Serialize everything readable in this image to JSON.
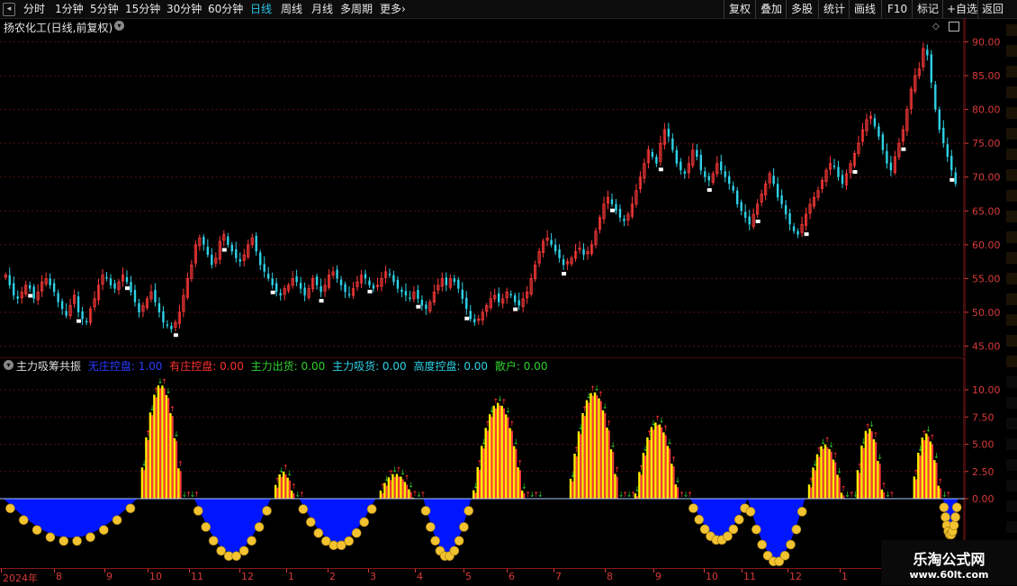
{
  "toolbar": {
    "periods": [
      "分时",
      "1分钟",
      "5分钟",
      "15分钟",
      "30分钟",
      "60分钟",
      "日线",
      "周线",
      "月线",
      "多周期",
      "更多"
    ],
    "active_period": "日线",
    "more_arrow": "›",
    "right_buttons": [
      "复权",
      "叠加",
      "多股",
      "统计",
      "画线",
      "F10",
      "标记",
      "+自选",
      "返回"
    ]
  },
  "main": {
    "title": "扬农化工(日线,前复权)",
    "y_ticks": [
      "90.00",
      "85.00",
      "80.00",
      "75.00",
      "70.00",
      "65.00",
      "60.00",
      "55.00",
      "50.00",
      "45.00"
    ]
  },
  "sub": {
    "indicator_name": "主力吸筹共振",
    "values": [
      {
        "label": "无庄控盘: 1.00",
        "color": "#2a3cff"
      },
      {
        "label": "有庄控盘: 0.00",
        "color": "#ff3030"
      },
      {
        "label": "主力出货: 0.00",
        "color": "#2ed12e"
      },
      {
        "label": "主力吸货: 0.00",
        "color": "#2ed1e6"
      },
      {
        "label": "高度控盘: 0.00",
        "color": "#2ed1e6"
      },
      {
        "label": "散户: 0.00",
        "color": "#2ed12e"
      }
    ],
    "y_ticks": [
      "10.00",
      "7.50",
      "5.00",
      "2.50",
      "0.00"
    ]
  },
  "x_axis": {
    "labels": [
      "2024年",
      "8",
      "9",
      "10",
      "11",
      "12",
      "1",
      "2",
      "3",
      "4",
      "5",
      "6",
      "7",
      "8",
      "9",
      "10",
      "11",
      "12",
      "1"
    ]
  },
  "watermark": {
    "title": "乐淘公式网",
    "url": "www.60lt.com"
  },
  "colors": {
    "up": "#ff3a3a",
    "down": "#2ed1e6",
    "grid": "#5a0f0f",
    "yellow": "#ffee00",
    "blue": "#0016ff"
  },
  "chart_data": {
    "type": "candlestick",
    "ylim": [
      44,
      91
    ],
    "close_series": [
      55.5,
      54,
      52.5,
      52,
      53,
      54,
      53.5,
      52,
      53,
      54.5,
      55,
      54,
      53,
      51.5,
      50.5,
      49.5,
      51,
      52.5,
      50,
      49,
      48.5,
      50.5,
      52,
      54,
      55.5,
      55,
      54,
      53.5,
      54.5,
      55.5,
      54.5,
      53,
      51.5,
      50,
      51,
      52,
      53,
      51.5,
      50,
      48.5,
      48,
      47.5,
      48.5,
      50,
      52.5,
      55,
      57,
      60,
      61,
      60,
      58.5,
      57,
      58,
      60.5,
      61.5,
      60,
      59,
      58,
      57.5,
      58.5,
      60,
      61,
      59,
      57,
      56,
      55,
      54,
      53,
      52.5,
      53.5,
      54,
      55,
      54.5,
      53.5,
      52.5,
      53.5,
      55,
      54,
      53,
      54,
      55.5,
      56,
      55,
      54,
      53,
      52.5,
      53.5,
      54.5,
      55.5,
      55,
      54,
      53.5,
      54,
      55,
      56,
      55.5,
      54.5,
      53.5,
      53,
      52.5,
      52,
      53,
      52,
      51,
      50.5,
      51.5,
      53,
      54,
      55,
      54,
      55,
      54.5,
      53.5,
      52,
      50.5,
      49,
      48.5,
      49,
      50,
      51,
      52,
      52.5,
      51.5,
      52,
      53,
      52.5,
      51.5,
      51,
      52,
      53,
      55,
      57,
      59,
      60.5,
      61,
      60,
      59,
      58,
      57,
      57.5,
      58,
      59,
      59.5,
      58.5,
      59,
      60,
      62,
      64,
      66,
      67,
      66,
      65,
      64,
      63.5,
      64.5,
      66,
      68,
      70,
      72,
      74,
      73,
      72,
      75,
      77,
      76,
      74,
      72,
      71,
      70.5,
      72,
      74,
      73,
      71,
      70,
      69.5,
      70.5,
      72,
      71,
      70,
      69,
      68,
      66,
      65,
      64,
      63,
      64.5,
      66,
      67.5,
      69,
      70.5,
      69,
      67,
      66,
      64.5,
      63,
      62,
      61.5,
      63,
      64.5,
      66,
      67,
      68,
      69.5,
      71,
      72,
      71.5,
      70,
      69,
      70.5,
      72,
      73.5,
      75,
      77,
      78.5,
      79,
      77.5,
      76,
      74,
      72,
      71,
      73,
      75,
      77,
      80,
      83,
      85,
      86,
      89,
      88,
      84,
      80,
      77,
      75,
      73,
      71,
      69
    ]
  }
}
